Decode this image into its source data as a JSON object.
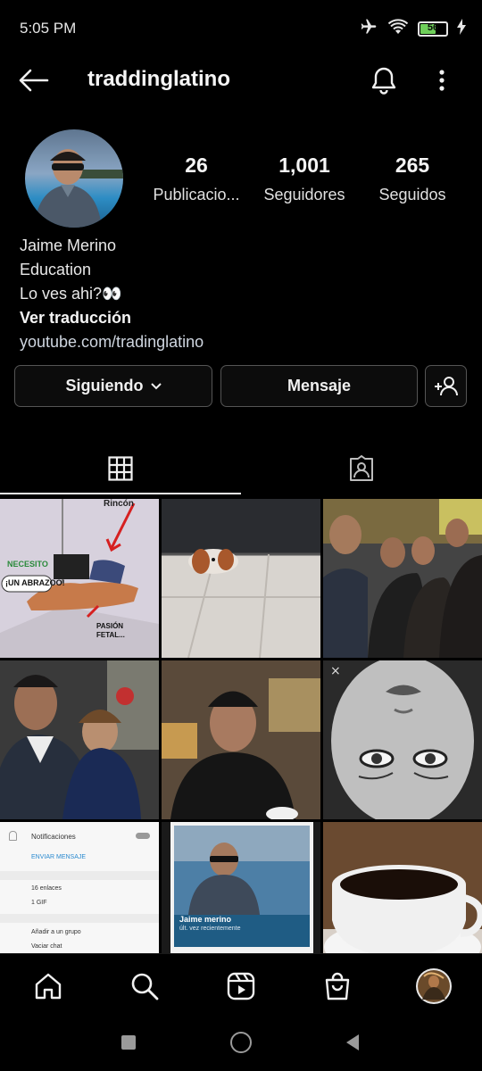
{
  "status": {
    "time": "5:05 PM",
    "battery": "56",
    "battery_level": 0.56
  },
  "header": {
    "username": "traddinglatino"
  },
  "stats": [
    {
      "value": "26",
      "label": "Publicacio..."
    },
    {
      "value": "1,001",
      "label": "Seguidores"
    },
    {
      "value": "265",
      "label": "Seguidos"
    }
  ],
  "bio": {
    "name": "Jaime Merino",
    "category": "Education",
    "text": "Lo ves ahi?👀",
    "translate": "Ver traducción",
    "link": "youtube.com/tradinglatino"
  },
  "buttons": {
    "following": "Siguiendo",
    "message": "Mensaje"
  },
  "grid_text": {
    "cartoon_top": "Rincón",
    "cartoon_need": "NECESITO",
    "cartoon_hug": "¡UN ABRAZOO!",
    "cartoon_passion": "PASIÓN FETAL...",
    "settings_notif": "Notificaciones",
    "settings_send": "ENVIAR MENSAJE",
    "settings_links": "16 enlaces",
    "settings_gif": "1 GIF",
    "settings_group": "Añadir a un grupo",
    "settings_clear": "Vaciar chat",
    "phone_name": "Jaime merino",
    "phone_status": "últ. vez recientemente"
  },
  "colors": {
    "background": "#000000",
    "text": "#f5f5f5",
    "border": "#555555",
    "battery": "#6fcf5a"
  }
}
